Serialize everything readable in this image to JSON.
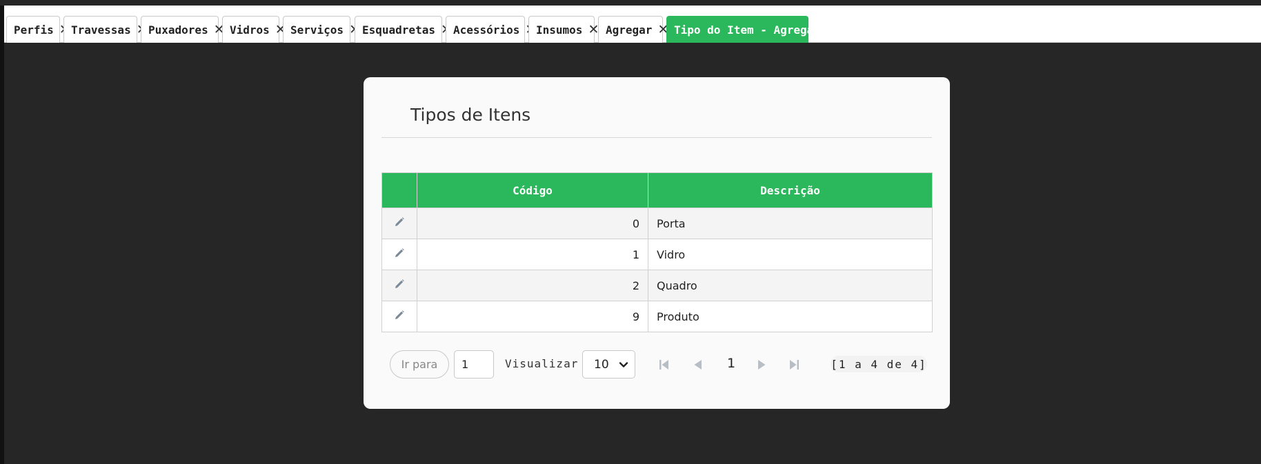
{
  "tabs": [
    {
      "label": "Perfis",
      "active": false
    },
    {
      "label": "Travessas",
      "active": false
    },
    {
      "label": "Puxadores",
      "active": false
    },
    {
      "label": "Vidros",
      "active": false
    },
    {
      "label": "Serviços",
      "active": false
    },
    {
      "label": "Esquadretas",
      "active": false
    },
    {
      "label": "Acessórios",
      "active": false
    },
    {
      "label": "Insumos",
      "active": false
    },
    {
      "label": "Agregar",
      "active": false
    },
    {
      "label": "Tipo do Item - Agregar",
      "active": true
    }
  ],
  "tab_close_glyph": "✕",
  "panel": {
    "title": "Tipos de Itens"
  },
  "table": {
    "columns": [
      "",
      "Código",
      "Descrição"
    ],
    "rows": [
      {
        "codigo": "0",
        "descricao": "Porta"
      },
      {
        "codigo": "1",
        "descricao": "Vidro"
      },
      {
        "codigo": "2",
        "descricao": "Quadro"
      },
      {
        "codigo": "9",
        "descricao": "Produto"
      }
    ],
    "row_action_icon": "pencil-icon"
  },
  "pager": {
    "goto_label": "Ir para",
    "goto_value": "1",
    "view_label": "Visualizar",
    "page_size": "10",
    "current_page": "1",
    "range_text": "[1 a 4 de 4]"
  },
  "colors": {
    "accent": "#2bb75b",
    "background": "#262626",
    "panel": "#fafafa"
  }
}
